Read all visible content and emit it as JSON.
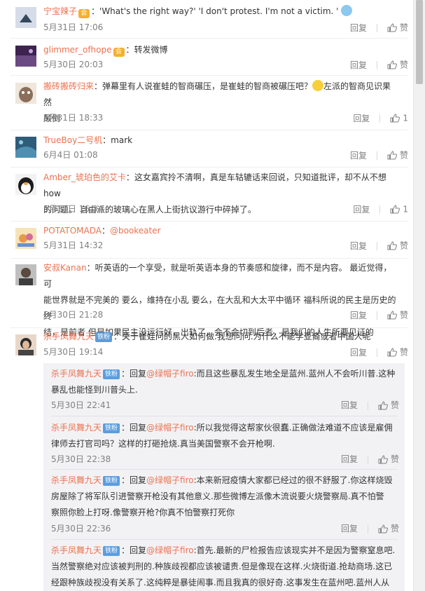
{
  "comments": [
    {
      "name": "宁宝辣子",
      "has_vip": true,
      "text_pre": "：'What's the right way?' 'I don't protest. I'm not a victim. '",
      "text_post": "",
      "emoji": "blue",
      "time": "5月31日 17:06",
      "reply": "回复",
      "like": "赞",
      "avatar_color": "#c8d3e2"
    },
    {
      "name": "glimmer_ofhope",
      "has_vip": true,
      "text_pre": "：转发微博",
      "time": "5月30日 20:03",
      "reply": "回复",
      "like": "赞",
      "avatar_color": "#5b3a6e"
    },
    {
      "name": "搬砖搬砖归来",
      "text_pre": "：弹幕里有人说崔蛙的智商碾压，是崔蛙的智商被碾压吧？",
      "text_post": "左派的智商见识果然",
      "line2": "颠倒",
      "time": "5月31日 18:33",
      "reply": "回复",
      "like": "1",
      "avatar_color": "#8b6f5a"
    },
    {
      "name": "TrueBoy二号机",
      "text_pre": "：mark",
      "time": "6月4日 01:08",
      "reply": "回复",
      "like": "赞",
      "avatar_color": "#2f5c7a"
    },
    {
      "name": "Amber_琥珀色的艾卡",
      "text_pre": "：这女嘉宾拎不清啊，真是车轱辘话来回说，只知道批评，却不从不想how",
      "line2": "的问题。 自由派的玻璃心在黑人上街抗议游行中碎掉了。",
      "time": "5月31日 16:34",
      "reply": "回复",
      "like": "1",
      "avatar_color": "#222222"
    },
    {
      "name": "POTATOMADA",
      "text_pre": "：",
      "mention": "@bookeater",
      "time": "5月31日 14:32",
      "reply": "回复",
      "like": "赞",
      "avatar_color": "#e5b36a"
    },
    {
      "name": "安叔Kanan",
      "text_pre": "：听英语的一个享受，就是听英语本身的节奏感和旋律，而不是内容。  最近觉得，可",
      "line2": "能世界就是不完美的 要么，维持在小乱 要么，在大乱和大太平中循环  福科所说的民主是历史的终",
      "line3": "结，是前者 但是如果民主没运行好，出轨了，会不会切到后者，是我们的人生所要见证的",
      "time": "5月30日 21:28",
      "reply": "回复",
      "like": "赞",
      "avatar_color": "#6d6d6d"
    },
    {
      "name": "杀手凤舞九天",
      "fan_badge": "铁粉",
      "text_pre": "：关于崔娃问的黑人如何做.我想问问.为什么不能学亚裔或者中国人呢",
      "time": "5月30日 19:14",
      "reply": "回复",
      "like": "赞",
      "avatar_color": "#3a3a3a"
    }
  ],
  "subreplies": [
    {
      "name": "杀手凤舞九天",
      "fan_badge": "铁粉",
      "reply_word": "：回复",
      "mention": "@绿帽子firo",
      "text": ":而且这些暴乱发生地全是蓝州.蓝州人不会听川普.这种",
      "line2": "暴乱也能怪到川普头上.",
      "time": "5月30日 22:41",
      "reply": "回复",
      "like": "赞"
    },
    {
      "name": "杀手凤舞九天",
      "fan_badge": "铁粉",
      "reply_word": "：回复",
      "mention": "@绿帽子firo",
      "text": ":所以我觉得这帮家伙很蠢.正确做法难道不应该是雇佣",
      "line2": "律师去打官司吗？这样的打砸抢烧.真当美国警察不会开枪啊.",
      "time": "5月30日 22:38",
      "reply": "回复",
      "like": "赞"
    },
    {
      "name": "杀手凤舞九天",
      "fan_badge": "铁粉",
      "reply_word": "：回复",
      "mention": "@绿帽子firo",
      "text": ":本来新冠疫情大家都已经过的很不舒服了.你这样烧毁",
      "line2": "房屋除了将军队引进警察开枪没有其他意义.那些微博左派像木流说要火烧警察局.真不怕警",
      "line3": "察照你脸上打呀.像警察开枪?你真不怕警察打死你",
      "time": "5月30日 22:36",
      "reply": "回复",
      "like": "赞"
    },
    {
      "name": "杀手凤舞九天",
      "fan_badge": "铁粉",
      "reply_word": "：回复",
      "mention": "@绿帽子firo",
      "text": ":首先.最新的尸检报告应该现实并不是因为警察窒息吧.",
      "line2": "当然警察绝对应该被判刑的.种族歧视都应该被谴责.但是像现在这样.火烧街道.抢劫商场.这已",
      "line3": "经跟种族歧视没有关系了.这纯粹是暴徒闹事.而且我真的很好奇.这事发生在蓝州吧.蓝州人从来"
    }
  ]
}
